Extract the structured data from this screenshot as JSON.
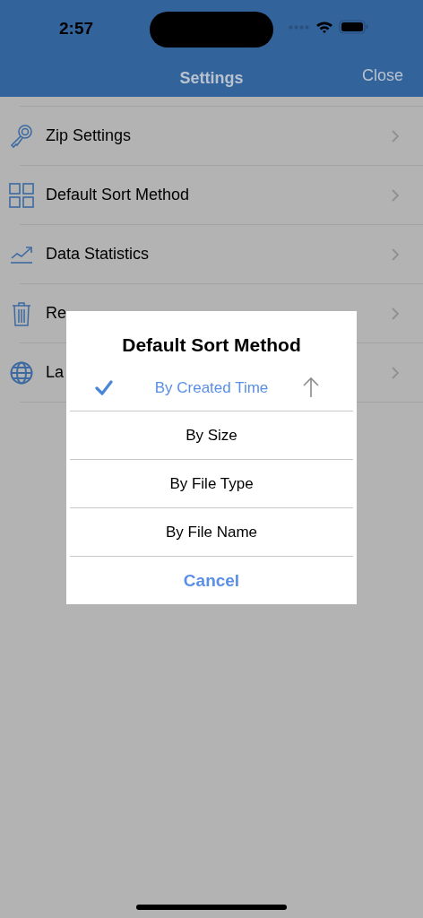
{
  "status_bar": {
    "time": "2:57"
  },
  "nav_bar": {
    "title": "Settings",
    "close": "Close"
  },
  "settings": [
    {
      "kind": "key",
      "label": "Zip Settings"
    },
    {
      "kind": "grid",
      "label": "Default Sort Method"
    },
    {
      "kind": "chart",
      "label": "Data Statistics"
    },
    {
      "kind": "trash",
      "label": "Re"
    },
    {
      "kind": "globe",
      "label": "La"
    }
  ],
  "dialog": {
    "title": "Default Sort Method",
    "options": [
      {
        "label": "By Created Time",
        "selected": true,
        "ascending": true
      },
      {
        "label": "By Size",
        "selected": false
      },
      {
        "label": "By File Type",
        "selected": false
      },
      {
        "label": "By File Name",
        "selected": false
      }
    ],
    "cancel": "Cancel"
  }
}
